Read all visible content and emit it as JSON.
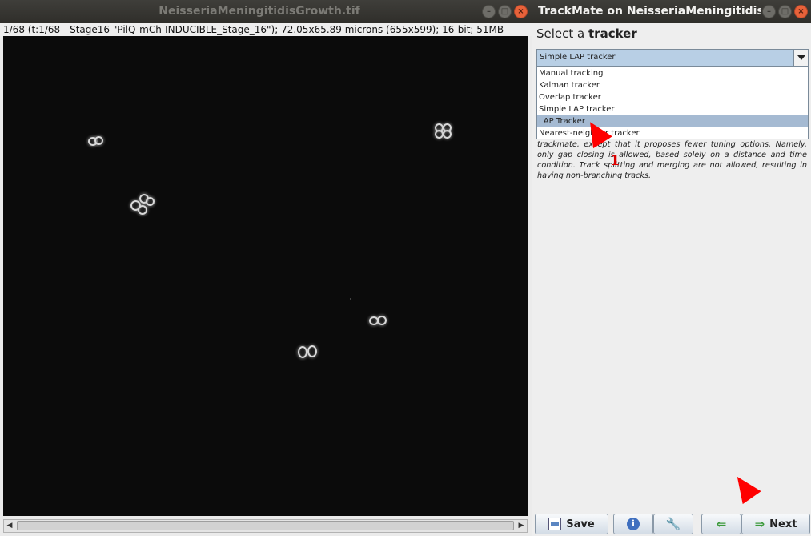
{
  "image_window": {
    "title": "NeisseriaMeningitidisGrowth.tif",
    "info": "1/68 (t:1/68 - Stage16 \"PilQ-mCh-INDUCIBLE_Stage_16\"); 72.05x65.89 microns (655x599); 16-bit; 51MB",
    "controls": [
      "minimize-icon",
      "maximize-icon",
      "close-icon"
    ]
  },
  "trackmate": {
    "title": "TrackMate on NeisseriaMeningitidisG...",
    "select_prefix": "Select a ",
    "select_bold": "tracker",
    "combo_value": "Simple LAP tracker",
    "options": [
      "Manual tracking",
      "Kalman tracker",
      "Overlap tracker",
      "Simple LAP tracker",
      "LAP Tracker",
      "Nearest-neighbor tracker"
    ],
    "highlighted_option": "LAP Tracker",
    "description": "trackmate, except that it proposes fewer tuning options. Namely, only gap closing is allowed, based solely on a distance and time condition. Track splitting and merging are not allowed, resulting in having non-branching tracks.",
    "buttons": {
      "save": "Save",
      "next": "Next"
    }
  },
  "annotations": {
    "step_number": "1",
    "color": "#ff0000"
  },
  "colors": {
    "titlebar": "#33322e",
    "canvas": "#0b0b0b",
    "combo_selected": "#b8cfe5",
    "dropdown_highlight": "#a5bad2"
  }
}
